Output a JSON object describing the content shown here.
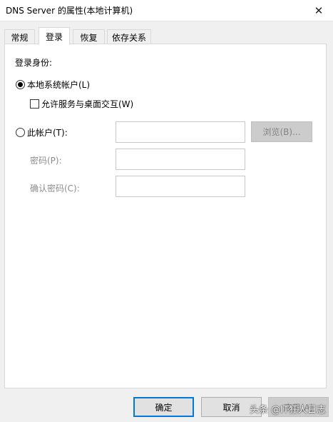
{
  "window": {
    "title": "DNS Server 的属性(本地计算机)",
    "close_symbol": "✕"
  },
  "tabs": [
    {
      "label": "常规",
      "active": false
    },
    {
      "label": "登录",
      "active": true
    },
    {
      "label": "恢复",
      "active": false
    },
    {
      "label": "依存关系",
      "active": false
    }
  ],
  "logon": {
    "section_label": "登录身份:",
    "local_system_label": "本地系统帐户(L)",
    "local_system_selected": true,
    "interact_desktop_label": "允许服务与桌面交互(W)",
    "interact_desktop_checked": false,
    "this_account_label": "此帐户(T):",
    "this_account_selected": false,
    "this_account_value": "",
    "browse_label": "浏览(B)...",
    "password_label": "密码(P):",
    "password_value": "",
    "confirm_password_label": "确认密码(C):",
    "confirm_password_value": ""
  },
  "buttons": {
    "ok_label": "确定",
    "cancel_label": "取消",
    "apply_label": "应用(A)"
  },
  "watermark": "头条 @IT狂人日志",
  "colors": {
    "default_button_border": "#0078d7",
    "panel_background": "#ffffff",
    "window_background": "#f0f0f0"
  }
}
